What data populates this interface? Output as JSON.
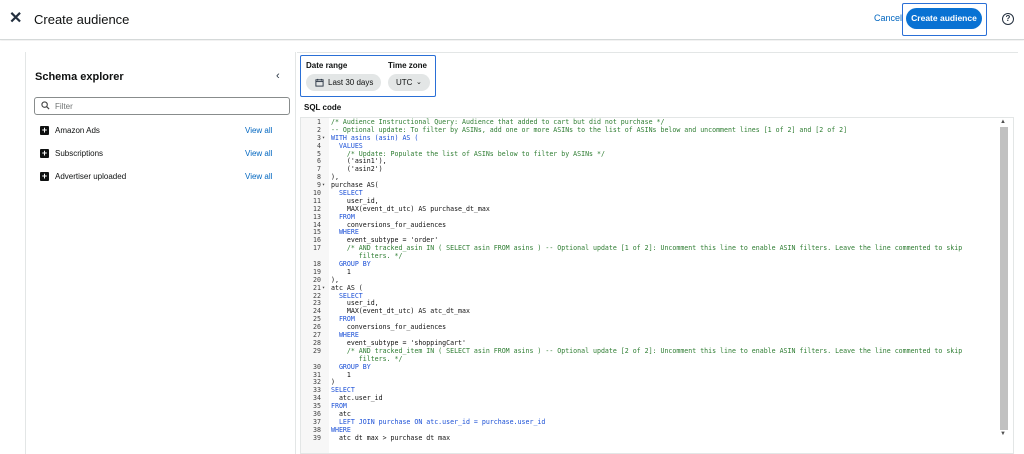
{
  "header": {
    "title": "Create audience",
    "close_icon": "close-icon",
    "cancel_label": "Cancel",
    "create_label": "Create audience",
    "help_icon": "help-icon",
    "help_glyph": "?"
  },
  "sidebar": {
    "title": "Schema explorer",
    "collapse_icon": "chevron-left-icon",
    "filter_placeholder": "Filter",
    "items": [
      {
        "label": "Amazon Ads",
        "action": "View all"
      },
      {
        "label": "Subscriptions",
        "action": "View all"
      },
      {
        "label": "Advertiser uploaded",
        "action": "View all"
      }
    ]
  },
  "filters": {
    "date_range_label": "Date range",
    "date_range_value": "Last 30 days",
    "time_zone_label": "Time zone",
    "time_zone_value": "UTC"
  },
  "sql": {
    "label": "SQL code",
    "lines": [
      {
        "n": "1",
        "fold": "",
        "text": "/* Audience Instructional Query: Audience that added to cart but did not purchase */"
      },
      {
        "n": "2",
        "fold": "",
        "text": "-- Optional update: To filter by ASINs, add one or more ASINs to the list of ASINs below and uncomment lines [1 of 2] and [2 of 2]"
      },
      {
        "n": "3",
        "fold": "▾",
        "text": "WITH asins (asin) AS ("
      },
      {
        "n": "4",
        "fold": "",
        "text": "  VALUES"
      },
      {
        "n": "5",
        "fold": "",
        "text": "    /* Update: Populate the list of ASINs below to filter by ASINs */"
      },
      {
        "n": "6",
        "fold": "",
        "text": "    ('asin1'),"
      },
      {
        "n": "7",
        "fold": "",
        "text": "    ('asin2')"
      },
      {
        "n": "8",
        "fold": "",
        "text": "),"
      },
      {
        "n": "9",
        "fold": "▾",
        "text": "purchase AS("
      },
      {
        "n": "10",
        "fold": "",
        "text": "  SELECT"
      },
      {
        "n": "11",
        "fold": "",
        "text": "    user_id,"
      },
      {
        "n": "12",
        "fold": "",
        "text": "    MAX(event_dt_utc) AS purchase_dt_max"
      },
      {
        "n": "13",
        "fold": "",
        "text": "  FROM"
      },
      {
        "n": "14",
        "fold": "",
        "text": "    conversions_for_audiences"
      },
      {
        "n": "15",
        "fold": "",
        "text": "  WHERE"
      },
      {
        "n": "16",
        "fold": "",
        "text": "    event_subtype = 'order'"
      },
      {
        "n": "17",
        "fold": "",
        "text": "    /* AND tracked_asin IN ( SELECT asin FROM asins ) -- Optional update [1 of 2]: Uncomment this line to enable ASIN filters. Leave the line commented to skip"
      },
      {
        "n": "",
        "fold": "",
        "text": "       filters. */"
      },
      {
        "n": "18",
        "fold": "",
        "text": "  GROUP BY"
      },
      {
        "n": "19",
        "fold": "",
        "text": "    1"
      },
      {
        "n": "20",
        "fold": "",
        "text": "),"
      },
      {
        "n": "21",
        "fold": "▾",
        "text": "atc AS ("
      },
      {
        "n": "22",
        "fold": "",
        "text": "  SELECT"
      },
      {
        "n": "23",
        "fold": "",
        "text": "    user_id,"
      },
      {
        "n": "24",
        "fold": "",
        "text": "    MAX(event_dt_utc) AS atc_dt_max"
      },
      {
        "n": "25",
        "fold": "",
        "text": "  FROM"
      },
      {
        "n": "26",
        "fold": "",
        "text": "    conversions_for_audiences"
      },
      {
        "n": "27",
        "fold": "",
        "text": "  WHERE"
      },
      {
        "n": "28",
        "fold": "",
        "text": "    event_subtype = 'shoppingCart'"
      },
      {
        "n": "29",
        "fold": "",
        "text": "    /* AND tracked_item IN ( SELECT asin FROM asins ) -- Optional update [2 of 2]: Uncomment this line to enable ASIN filters. Leave the line commented to skip"
      },
      {
        "n": "",
        "fold": "",
        "text": "       filters. */"
      },
      {
        "n": "30",
        "fold": "",
        "text": "  GROUP BY"
      },
      {
        "n": "31",
        "fold": "",
        "text": "    1"
      },
      {
        "n": "32",
        "fold": "",
        "text": ")"
      },
      {
        "n": "33",
        "fold": "",
        "text": "SELECT"
      },
      {
        "n": "34",
        "fold": "",
        "text": "  atc.user_id"
      },
      {
        "n": "35",
        "fold": "",
        "text": "FROM"
      },
      {
        "n": "36",
        "fold": "",
        "text": "  atc"
      },
      {
        "n": "37",
        "fold": "",
        "text": "  LEFT JOIN purchase ON atc.user_id = purchase.user_id"
      },
      {
        "n": "38",
        "fold": "",
        "text": "WHERE"
      },
      {
        "n": "39",
        "fold": "",
        "text": "  atc dt max > purchase dt max"
      }
    ]
  },
  "colors": {
    "primary": "#0972d3",
    "link": "#0066c0",
    "highlight_border": "#2a6fd6",
    "comment": "#2e7d32",
    "keyword": "#1a4fd6",
    "string": "#b5178f"
  }
}
